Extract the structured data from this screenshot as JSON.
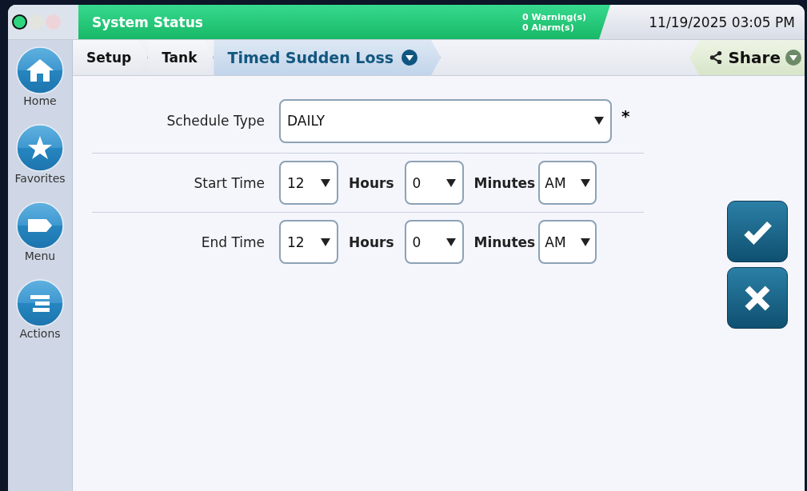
{
  "header": {
    "title": "System Status",
    "warnings": "0 Warning(s)",
    "alarms": "0 Alarm(s)",
    "datetime": "11/19/2025 03:05 PM"
  },
  "breadcrumbs": [
    {
      "label": "Setup",
      "selected": false
    },
    {
      "label": "Tank",
      "selected": false
    },
    {
      "label": "Timed Sudden Loss",
      "selected": true
    }
  ],
  "share": {
    "label": "Share"
  },
  "sidebar": [
    {
      "label": "Home",
      "kind": "home"
    },
    {
      "label": "Favorites",
      "kind": "star"
    },
    {
      "label": "Menu",
      "kind": "tag"
    },
    {
      "label": "Actions",
      "kind": "list"
    }
  ],
  "form": {
    "schedule": {
      "label": "Schedule Type",
      "value": "DAILY",
      "required": "*"
    },
    "times": [
      {
        "label": "Start Time",
        "hours": "12",
        "hours_unit": "Hours",
        "minutes": "0",
        "minutes_unit": "Minutes",
        "ampm": "AM"
      },
      {
        "label": "End Time",
        "hours": "12",
        "hours_unit": "Hours",
        "minutes": "0",
        "minutes_unit": "Minutes",
        "ampm": "AM"
      }
    ]
  }
}
